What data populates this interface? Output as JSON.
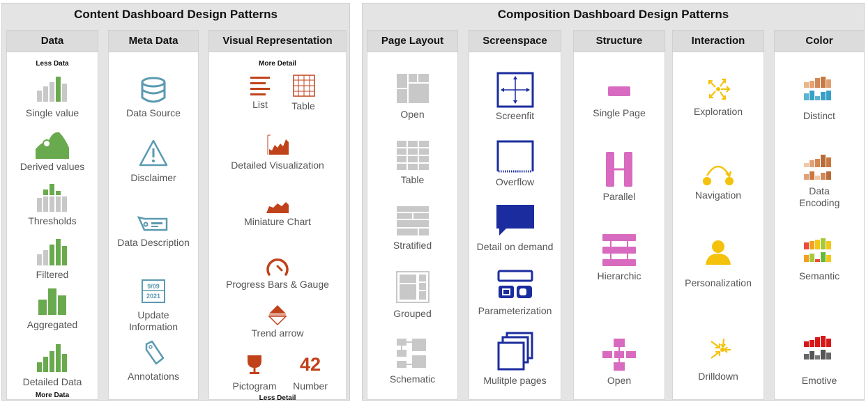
{
  "content_title": "Content Dashboard Design Patterns",
  "composition_title": "Composition Dashboard Design Patterns",
  "data_col": {
    "header": "Data",
    "top_note": "Less Data",
    "bottom_note": "More Data",
    "items": [
      "Single value",
      "Derived values",
      "Thresholds",
      "Filtered",
      "Aggregated",
      "Detailed Data"
    ]
  },
  "meta_col": {
    "header": "Meta Data",
    "items": [
      "Data Source",
      "Disclaimer",
      "Data Description",
      "Update Information",
      "Annotations"
    ],
    "calendar_date": "9/09",
    "calendar_year": "2021"
  },
  "visual_col": {
    "header": "Visual Representation",
    "top_note": "More Detail",
    "bottom_note": "Less Detail",
    "list": "List",
    "table": "Table",
    "detailed": "Detailed Visualization",
    "miniature": "Miniature Chart",
    "progress": "Progress Bars & Gauge",
    "trend": "Trend arrow",
    "pictogram": "Pictogram",
    "number_label": "Number",
    "number_value": "42"
  },
  "layout_col": {
    "header": "Page Layout",
    "items": [
      "Open",
      "Table",
      "Stratified",
      "Grouped",
      "Schematic"
    ]
  },
  "screen_col": {
    "header": "Screenspace",
    "items": [
      "Screenfit",
      "Overflow",
      "Detail on demand",
      "Parameterization",
      "Mulitple pages"
    ]
  },
  "structure_col": {
    "header": "Structure",
    "items": [
      "Single Page",
      "Parallel",
      "Hierarchic",
      "Open"
    ]
  },
  "interaction_col": {
    "header": "Interaction",
    "items": [
      "Exploration",
      "Navigation",
      "Personalization",
      "Drilldown"
    ]
  },
  "color_col": {
    "header": "Color",
    "items": [
      "Distinct",
      "Data Encoding",
      "Semantic",
      "Emotive"
    ]
  },
  "colors": {
    "data_green": "#6aaa4f",
    "bar_gray": "#c8c8c8",
    "meta_blue": "#5b9ab0",
    "visual_red": "#c0421b",
    "layout_gray": "#c8c8c8",
    "screen_navy": "#1b2d9e",
    "structure_pink": "#d86bbf",
    "interaction_yellow": "#f4c20d"
  }
}
